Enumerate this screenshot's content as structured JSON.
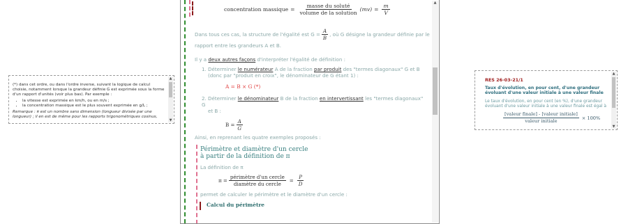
{
  "left_note": {
    "intro": "(*) dans cet ordre, ou dans l'ordre inverse, suivant la logique de calcul choisie, notamment lorsque la grandeur définie G est exprimée sous la forme d'un rapport d'unités (voir plus bas). Par exemple :",
    "bullets": [
      "la vitesse est exprimée en km/h, ou en m/s ;",
      "la concentration massique est le plus souvent exprimée en g/L ;"
    ],
    "remark": "Remarque : π est un nombre sans dimension (longueur divisée par une longueur) ; il en est de même pour les rapports trigonométriques cosinus,"
  },
  "main": {
    "conc_label": "concentration massique",
    "conc_num": "masse du soluté",
    "conc_den": "volume de la solution",
    "conc_sym": "(mv)",
    "conc_m": "m",
    "conc_v": "V",
    "p1_a": "Dans tous ces cas, la structure de l'égalité est G =",
    "p1_A": "A",
    "p1_B": "B",
    "p1_b": ", où G désigne la grandeur définie par le",
    "p1_c": "rapport entre les grandeurs A et B.",
    "p2_a": "Il y a",
    "p2_link": "deux autres façons",
    "p2_b": "d'interpréter l'égalité de définition :",
    "item1_num": "1.",
    "item1_a": "Déterminer",
    "item1_link1": "le numérateur",
    "item1_b": "A de la fraction",
    "item1_link2": "par produit",
    "item1_c": "des \"termes diagonaux\" G et B",
    "item1_d": "(donc par \"produit en croix\", le dénominateur de G étant 1) :",
    "item1_formula": "A = B × G (*)",
    "item2_num": "2.",
    "item2_a": "Déterminer",
    "item2_link1": "le dénominateur",
    "item2_b": "B de la fraction",
    "item2_link2": "en intervertissant",
    "item2_c": "les \"termes diagonaux\" G",
    "item2_d": "et B :",
    "item2_lhs": "B =",
    "item2_num_sym": "A",
    "item2_den_sym": "G",
    "p3": "Ainsi, en reprenant les quatre exemples proposés :",
    "sect_title_1": "Périmètre et diamètre d'un cercle",
    "sect_title_2": "à partir de la définition de π",
    "def_pi": "La définition de π",
    "pi_lhs": "π =",
    "pi_num": "périmètre d'un cercle",
    "pi_den": "diamètre du cercle",
    "pi_p": "P",
    "pi_d": "D",
    "p4": "permet de calculer le périmètre et le diamètre d'un cercle :",
    "sub_title": "Calcul du périmètre"
  },
  "right_card": {
    "code": "RES 26-03-21/1",
    "title": "Taux d'évolution, en pour cent, d'une grandeur évoluant d'une valeur initiale à une valeur finale",
    "text": "Le taux d'évolution, en pour cent (en %), d'une grandeur évoluant d'une valeur initiale à une valeur finale est égal à",
    "f_num": "[valeur finale] - [valeur initiale]",
    "f_den": "valeur initiale",
    "f_mult": "× 100%"
  },
  "colors": {
    "accent_teal": "#3a8080",
    "accent_red": "#e04040",
    "border_green": "#2e8b2e"
  }
}
